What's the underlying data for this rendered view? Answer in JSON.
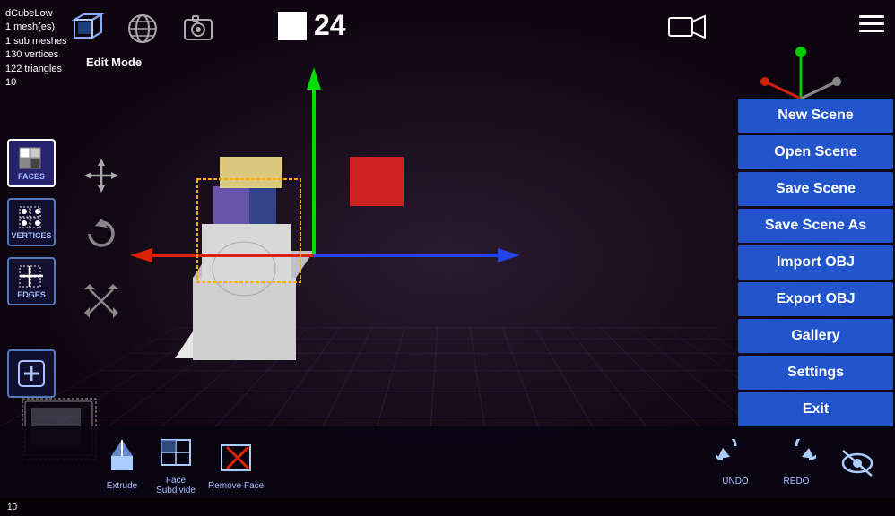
{
  "info": {
    "object_name": "dCubeLow",
    "mesh_count": "1 mesh(es)",
    "sub_mesh": "1 sub meshes",
    "vertices": "130 vertices",
    "triangles": "122 triangles",
    "number": "10"
  },
  "toolbar": {
    "edit_mode_label": "Edit Mode",
    "frame_number": "24"
  },
  "menu": {
    "buttons": [
      "New Scene",
      "Open Scene",
      "Save Scene",
      "Save Scene As",
      "Import OBJ",
      "Export OBJ",
      "Gallery",
      "Settings",
      "Exit"
    ]
  },
  "left_tools": [
    {
      "id": "faces",
      "label": "FACES"
    },
    {
      "id": "vertices",
      "label": "VERTICES"
    },
    {
      "id": "edges",
      "label": "EDGES"
    }
  ],
  "bottom_tools": [
    {
      "id": "extrude",
      "label": "Extrude"
    },
    {
      "id": "face-subdivide",
      "label": "Face\nSubdivide"
    },
    {
      "id": "remove-face",
      "label": "Remove Face"
    }
  ],
  "undo_label": "UNDO",
  "redo_label": "REDO",
  "coordinates": "10",
  "icons": {
    "cube": "cube-icon",
    "globe": "globe-icon",
    "camera_capture": "camera-capture-icon",
    "video_camera": "video-camera-icon",
    "hamburger": "hamburger-menu-icon",
    "faces": "faces-icon",
    "vertices": "vertices-icon",
    "edges": "edges-icon",
    "add": "add-icon",
    "nav_cross": "navigation-cross-icon",
    "undo_rotate": "undo-rotate-icon",
    "scale": "scale-icon",
    "eye_hidden": "eye-hidden-icon"
  },
  "colors": {
    "menu_bg": "#2255cc",
    "accent_green": "#00cc00",
    "accent_red": "#cc2200",
    "accent_blue": "#2244cc",
    "toolbar_bg": "#0a0514"
  }
}
